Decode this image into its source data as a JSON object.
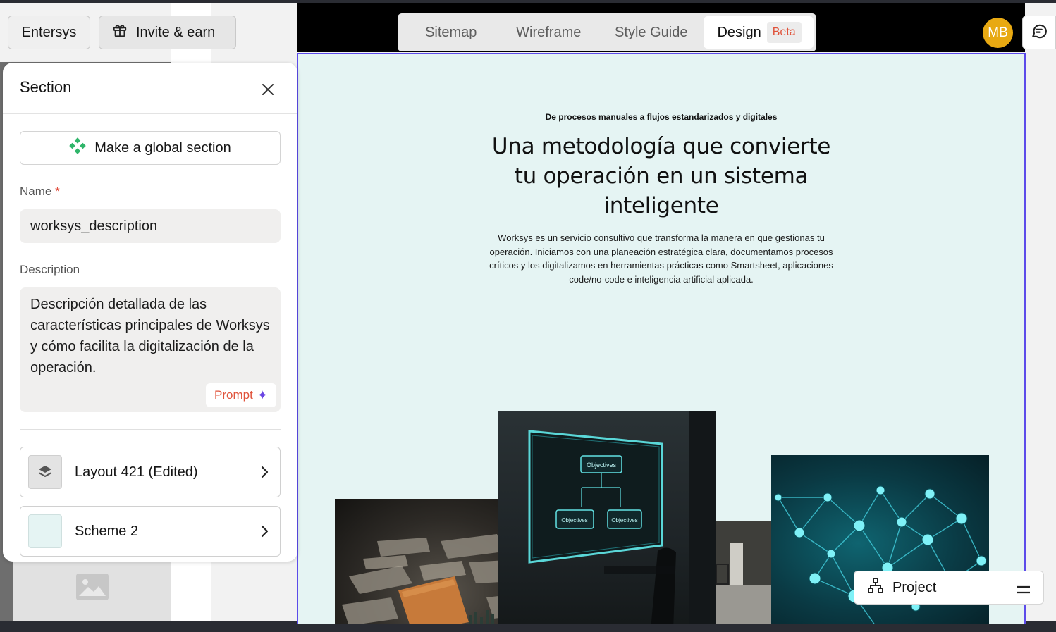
{
  "top": {
    "org_name": "Entersys",
    "invite_label": "Invite & earn"
  },
  "view_tabs": {
    "sitemap": "Sitemap",
    "wireframe": "Wireframe",
    "style_guide": "Style Guide",
    "design": "Design",
    "design_badge": "Beta",
    "active": "Design"
  },
  "user": {
    "avatar_initials": "MB",
    "avatar_color": "#e8a912"
  },
  "section_panel": {
    "title": "Section",
    "global_button": "Make a global section",
    "name_label": "Name",
    "name_required_mark": "*",
    "name_value": "worksys_description",
    "description_label": "Description",
    "description_value": "Descripción detallada de las características principales de Worksys y cómo facilita la digitalización de la operación.",
    "prompt_button": "Prompt",
    "layout_label": "Layout 421 (Edited)",
    "scheme_label": "Scheme 2"
  },
  "canvas": {
    "background": "#e5f4f3",
    "selection_color": "#5c4bea",
    "kicker": "De procesos manuales a flujos estandarizados y digitales",
    "title": "Una metodología que convierte tu operación en un sistema inteligente",
    "body": "Worksys es un servicio consultivo que transforma la manera en que gestionas tu operación. Iniciamos con una planeación estratégica clara, documentamos procesos críticos y los digitalizamos en herramientas prácticas como Smartsheet, aplicaciones code/no-code e inteligencia artificial aplicada.",
    "board_labels": {
      "top": "Objectives",
      "left": "Objectives",
      "right": "Objectives"
    }
  },
  "project_bar": {
    "label": "Project"
  },
  "icons": {
    "gift": "gift-icon",
    "chat": "chat-icon",
    "close": "close-icon",
    "component": "component-icon",
    "sparkle": "sparkle-icon",
    "layers": "layers-icon",
    "chevron": "chevron-right-icon",
    "sitemap": "sitemap-icon",
    "menu": "menu-icon"
  }
}
